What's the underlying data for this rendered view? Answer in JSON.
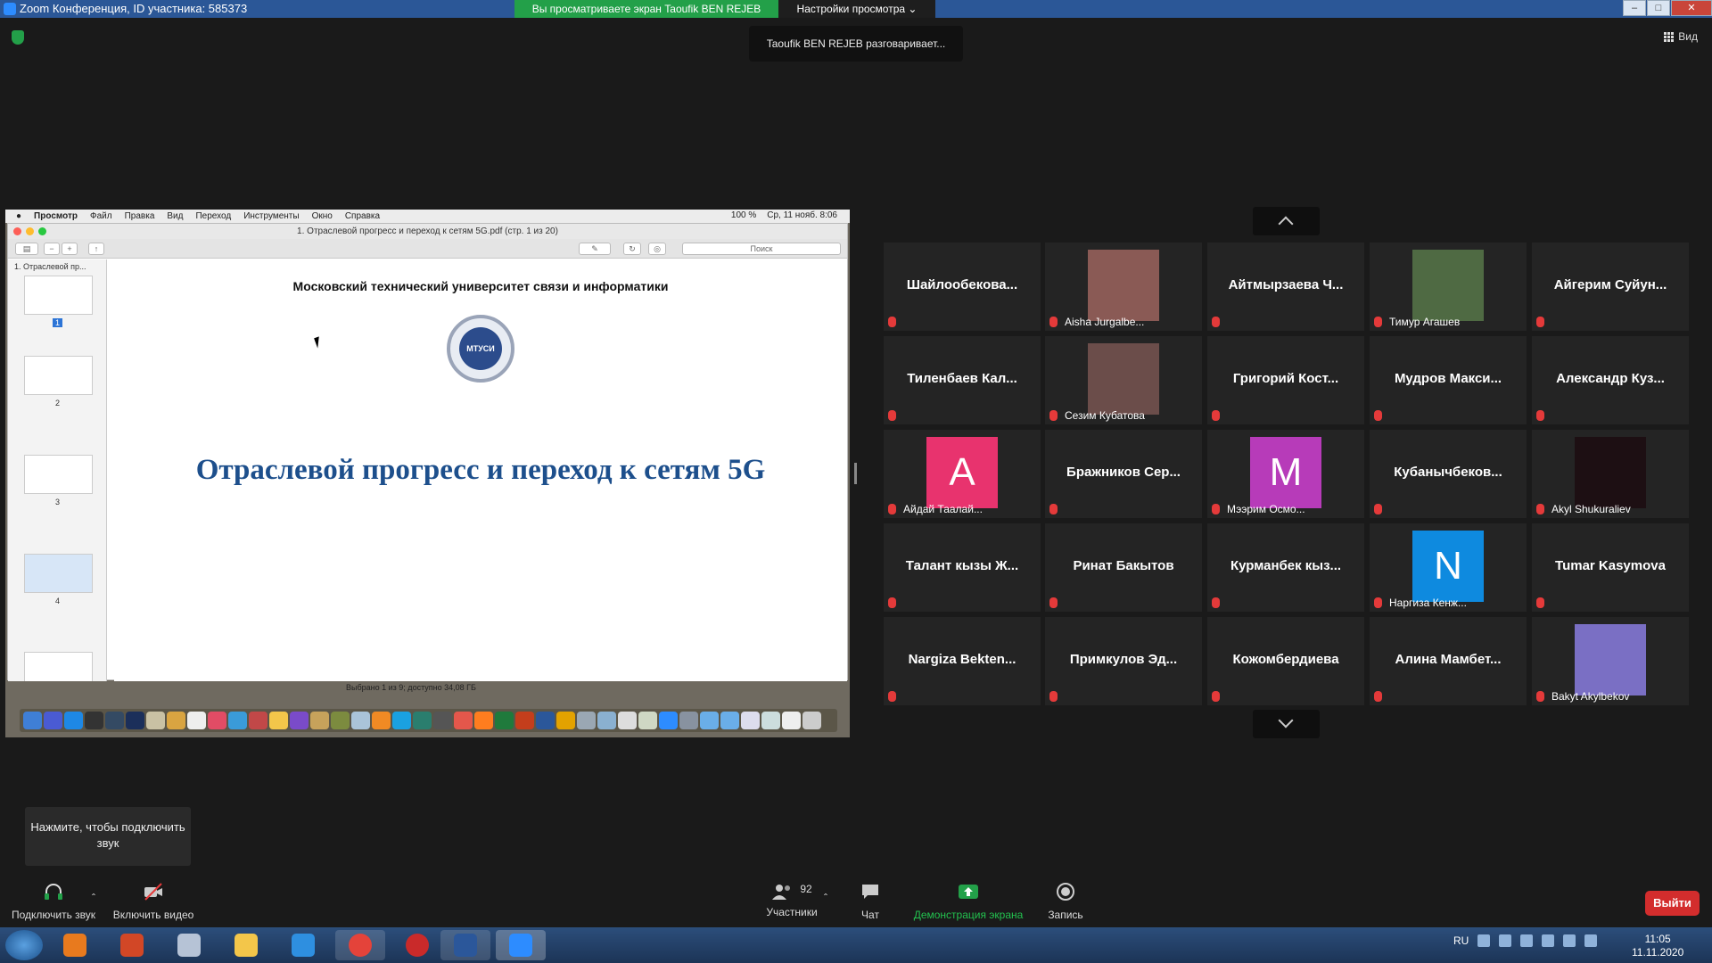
{
  "window": {
    "title": "Zoom Конференция, ID участника: 585373",
    "share_banner": "Вы просматриваете экран Taoufik BEN REJEB",
    "view_options": "Настройки просмотра",
    "speaking": "Taoufik BEN REJEB разговаривает...",
    "view_button": "Вид"
  },
  "shared_screen": {
    "mac_menu": [
      "Просмотр",
      "Файл",
      "Правка",
      "Вид",
      "Переход",
      "Инструменты",
      "Окно",
      "Справка"
    ],
    "mac_status": {
      "battery": "100 %",
      "datetime": "Ср, 11 нояб. 8:06"
    },
    "doc_title": "1. Отраслевой прогресс и переход к сетям 5G.pdf (стр. 1 из 20)",
    "search_placeholder": "Поиск",
    "sidebar_caption": "1. Отраслевой пр...",
    "thumb_numbers": [
      "1",
      "2",
      "3",
      "4"
    ],
    "university": "Московский технический университет связи и информатики",
    "logo_text": "МТУСИ",
    "headline": "Отраслевой прогресс и переход к сетям 5G",
    "status": "Выбрано 1 из 9; доступно 34,08 ГБ"
  },
  "participants": [
    {
      "name": "Шайлообекова...",
      "label": "",
      "avatar": ""
    },
    {
      "name": "",
      "label": "Aisha Jurgalbe...",
      "avatar": "photo",
      "color": "#8a5a55"
    },
    {
      "name": "Айтмырзаева Ч...",
      "label": "",
      "avatar": ""
    },
    {
      "name": "",
      "label": "Тимур Агашев",
      "avatar": "photo",
      "color": "#4f6a43"
    },
    {
      "name": "Айгерим Суйун...",
      "label": "",
      "avatar": ""
    },
    {
      "name": "Тиленбаев Кал...",
      "label": "",
      "avatar": ""
    },
    {
      "name": "",
      "label": "Сезим Кубатова",
      "avatar": "photo",
      "color": "#6b4d4a"
    },
    {
      "name": "Григорий Кост...",
      "label": "",
      "avatar": ""
    },
    {
      "name": "Мудров Макси...",
      "label": "",
      "avatar": ""
    },
    {
      "name": "Александр Куз...",
      "label": "",
      "avatar": ""
    },
    {
      "name": "",
      "label": "Айдай Таалай...",
      "avatar": "A",
      "color": "#e8336e"
    },
    {
      "name": "Бражников Сер...",
      "label": "",
      "avatar": ""
    },
    {
      "name": "",
      "label": "Мээрим Осмо...",
      "avatar": "M",
      "color": "#b73bb9"
    },
    {
      "name": "Кубанычбеков...",
      "label": "",
      "avatar": ""
    },
    {
      "name": "",
      "label": "Akyl Shukuraliev",
      "avatar": "photo",
      "color": "#1d0f13"
    },
    {
      "name": "Талант кызы Ж...",
      "label": "",
      "avatar": ""
    },
    {
      "name": "Ринат Бакытов",
      "label": "",
      "avatar": ""
    },
    {
      "name": "Курманбек кыз...",
      "label": "",
      "avatar": ""
    },
    {
      "name": "",
      "label": "Наргиза Кенж...",
      "avatar": "N",
      "color": "#0e8adf"
    },
    {
      "name": "Tumar Kasymova",
      "label": "",
      "avatar": ""
    },
    {
      "name": "Nargiza Bekten...",
      "label": "",
      "avatar": ""
    },
    {
      "name": "Примкулов Эд...",
      "label": "",
      "avatar": ""
    },
    {
      "name": "Кожомбердиева",
      "label": "",
      "avatar": ""
    },
    {
      "name": "Алина Мамбет...",
      "label": "",
      "avatar": ""
    },
    {
      "name": "",
      "label": "Bakyt Akylbekov",
      "avatar": "photo",
      "color": "#7a6fc4"
    }
  ],
  "tooltip": "Нажмите, чтобы подключить звук",
  "toolbar": {
    "audio": "Подключить звук",
    "video": "Включить видео",
    "participants": "Участники",
    "participants_count": "92",
    "chat": "Чат",
    "share": "Демонстрация экрана",
    "record": "Запись",
    "leave": "Выйти"
  },
  "taskbar": {
    "lang": "RU",
    "time": "11:05",
    "date": "11.11.2020"
  }
}
